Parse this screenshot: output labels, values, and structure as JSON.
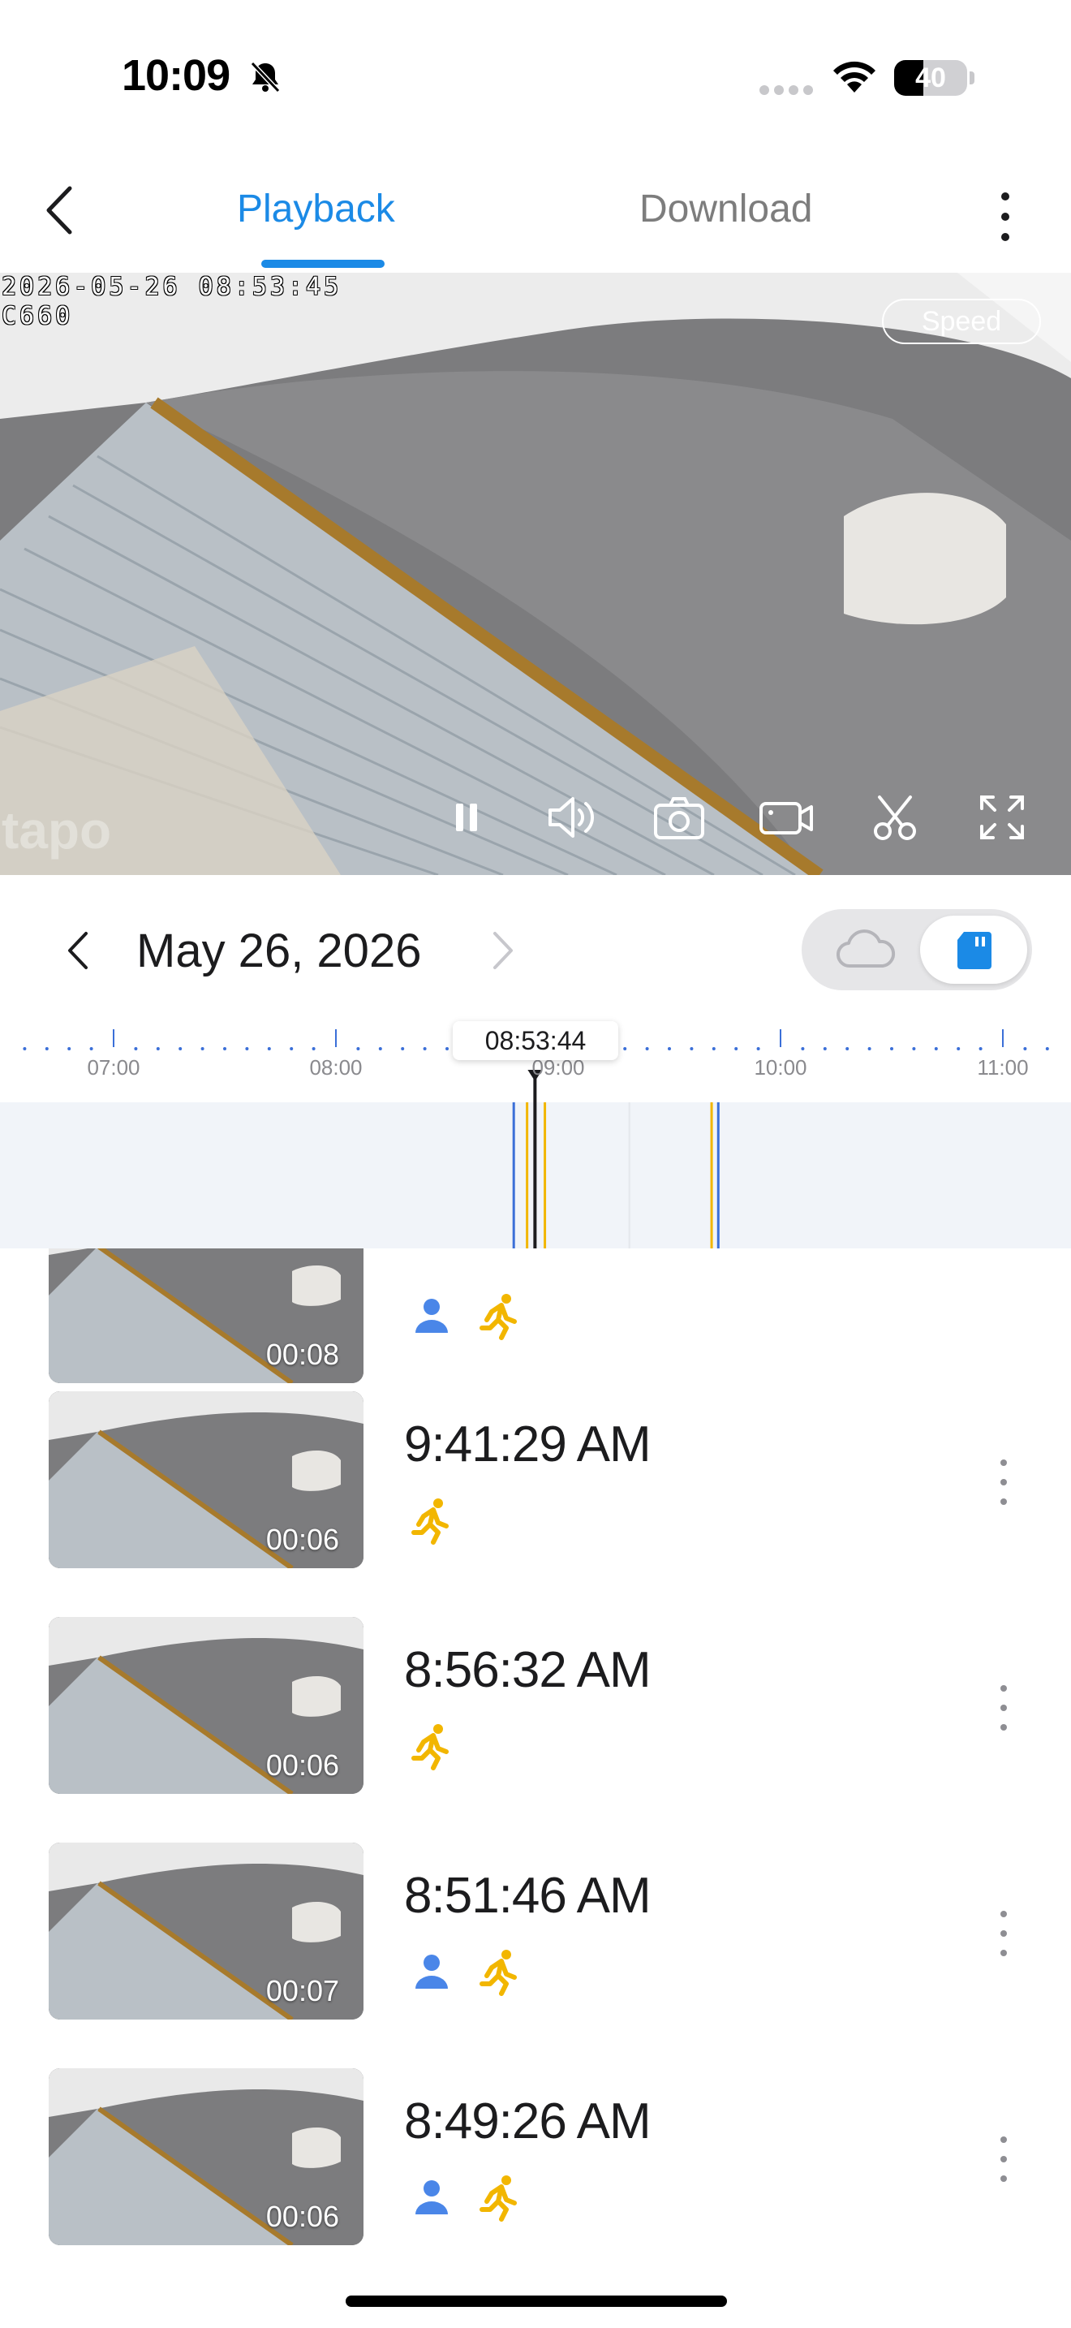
{
  "status_bar": {
    "time": "10:09",
    "battery": "40",
    "battery_level": 0.4
  },
  "nav": {
    "tab_playback": "Playback",
    "tab_download": "Download"
  },
  "video": {
    "osd_timestamp": "2026-05-26 08:53:45",
    "osd_camera": "C660",
    "speed_label": "Speed",
    "watermark": "tapo"
  },
  "date_row": {
    "date": "May 26, 2026"
  },
  "timeline": {
    "cursor_time": "08:53:44",
    "hour_labels": [
      "07:00",
      "08:00",
      "09:00",
      "10:00",
      "11:00"
    ]
  },
  "recordings": [
    {
      "time": "",
      "duration": "00:08",
      "tags": [
        "person",
        "motion"
      ]
    },
    {
      "time": "9:41:29 AM",
      "duration": "00:06",
      "tags": [
        "motion"
      ]
    },
    {
      "time": "8:56:32 AM",
      "duration": "00:06",
      "tags": [
        "motion"
      ]
    },
    {
      "time": "8:51:46 AM",
      "duration": "00:07",
      "tags": [
        "person",
        "motion"
      ]
    },
    {
      "time": "8:49:26 AM",
      "duration": "00:06",
      "tags": [
        "person",
        "motion"
      ]
    }
  ],
  "colors": {
    "accent": "#1b8ae6",
    "person_tag": "#4a86e8",
    "motion_tag": "#f2b600",
    "timeline_band": "#f1f4f9"
  }
}
